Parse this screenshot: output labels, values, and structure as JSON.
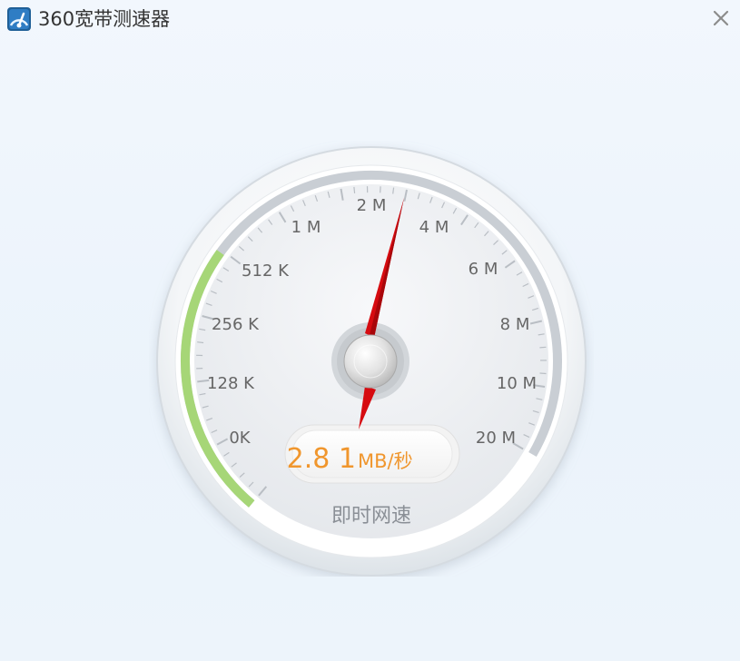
{
  "window": {
    "title": "360宽带测速器",
    "app_icon": "speedometer-icon",
    "close_icon": "close-icon"
  },
  "gauge": {
    "scale_labels": [
      "0K",
      "128 K",
      "256 K",
      "512 K",
      "1 M",
      "2 M",
      "4 M",
      "6 M",
      "8 M",
      "10 M",
      "20 M"
    ],
    "speed_value": "2.8 1",
    "speed_unit": "MB/秒",
    "caption": "即时网速",
    "progress_fraction": 0.33,
    "colors": {
      "progress": "#a6d677",
      "needle": "#d60b10",
      "readout_text": "#f0962d",
      "label_text": "#666666"
    }
  }
}
